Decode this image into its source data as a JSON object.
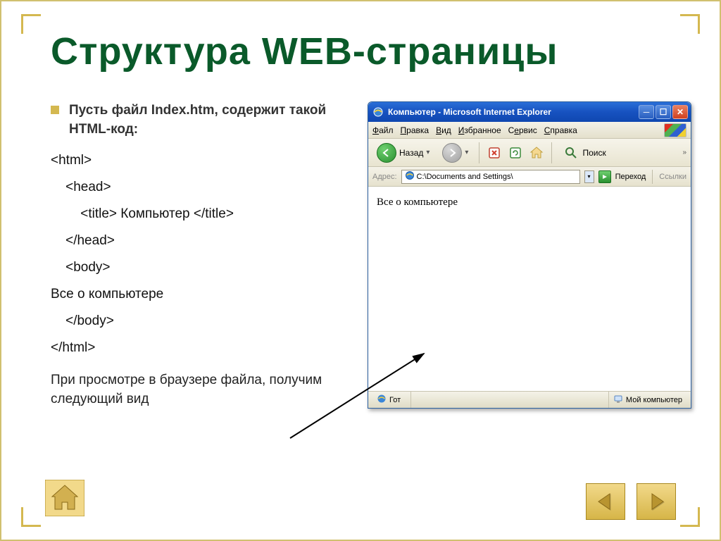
{
  "slide": {
    "title": "Структура WEB-страницы",
    "intro": "Пусть файл Index.htm, содержит такой HTML-код:",
    "code": [
      "<html>",
      "    <head>",
      "        <title> Компьютер </title>",
      "    </head>",
      "    <body>",
      "Все о компьютере",
      "    </body>",
      "</html>"
    ],
    "outro": "При просмотре в браузере файла, получим следующий вид"
  },
  "browser": {
    "title": "Компьютер - Microsoft Internet Explorer",
    "menu": {
      "file": "Файл",
      "edit": "Правка",
      "view": "Вид",
      "favorites": "Избранное",
      "tools": "Сервис",
      "help": "Справка"
    },
    "toolbar": {
      "back": "Назад",
      "search": "Поиск"
    },
    "address": {
      "label": "Адрес:",
      "value": "C:\\Documents and Settings\\",
      "go": "Переход",
      "links": "Ссылки"
    },
    "body_text": "Все о компьютере",
    "status": {
      "left": "Гот",
      "right": "Мой компьютер"
    }
  },
  "nav": {
    "home": "home",
    "prev": "prev",
    "next": "next"
  }
}
